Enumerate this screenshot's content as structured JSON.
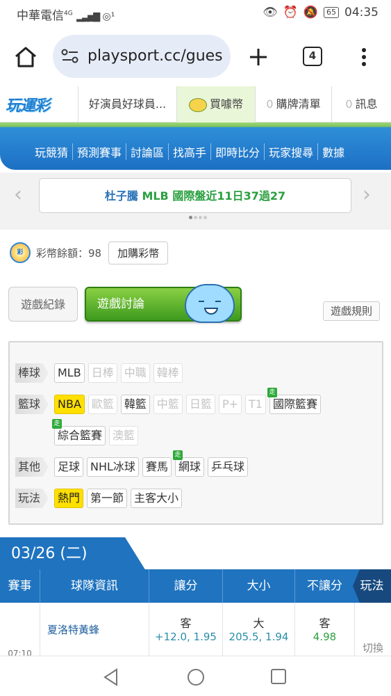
{
  "status_bar": {
    "carrier": "中華電信",
    "net": "4G",
    "time": "04:35",
    "battery": "65"
  },
  "browser": {
    "url": "playsport.cc/gues",
    "tab_count": "4"
  },
  "site_nav": {
    "logo": "玩運彩",
    "user_name": "好演員好球員...",
    "buy_coins": "買噱幣",
    "purchase_count": "0",
    "purchase_label": "購牌清單",
    "message_count": "0",
    "message_label": "訊息"
  },
  "main_menu": [
    "玩競猜",
    "預測賽事",
    "討論區",
    "找高手",
    "即時比分",
    "玩家搜尋",
    "數據"
  ],
  "ticker": {
    "name": "杜子騰",
    "league": "MLB",
    "text": "國際盤近11日37過27"
  },
  "balance": {
    "label": "彩幣餘額：98",
    "buy_button": "加購彩幣"
  },
  "game_tabs": {
    "record": "遊戲紀錄",
    "discussion": "遊戲討論",
    "rules": "遊戲規則"
  },
  "filters": {
    "baseball": {
      "label": "棒球",
      "items": [
        "MLB",
        "日棒",
        "中職",
        "韓棒"
      ]
    },
    "basketball": {
      "label": "籃球",
      "items": [
        "NBA",
        "歐籃",
        "韓籃",
        "中籃",
        "日籃",
        "P+",
        "T1",
        "國際籃賽",
        "綜合籃賽",
        "澳籃"
      ]
    },
    "other": {
      "label": "其他",
      "items": [
        "足球",
        "NHL冰球",
        "賽馬",
        "網球",
        "乒乓球"
      ]
    },
    "play": {
      "label": "玩法",
      "items": [
        "熱門",
        "第一節",
        "主客大小"
      ]
    },
    "walk_badge": "走"
  },
  "schedule": {
    "date": "03/26 (二)",
    "headers": [
      "賽事",
      "球隊資訊",
      "讓分",
      "大小",
      "不讓分",
      "玩法"
    ],
    "row": {
      "time": "07:10",
      "team": "夏洛特黃蜂",
      "spread_side": "客",
      "spread_odds": "+12.0, 1.95",
      "total_side": "大",
      "total_odds": "205.5, 1.94",
      "ml_side": "客",
      "ml_odds": "4.98",
      "switch": "切換"
    }
  },
  "colors": {
    "brand_blue": "#1f73bf",
    "accent_green": "#3d9a1e",
    "ticker_green": "#2aa040",
    "selected_yellow": "#ffe000"
  }
}
